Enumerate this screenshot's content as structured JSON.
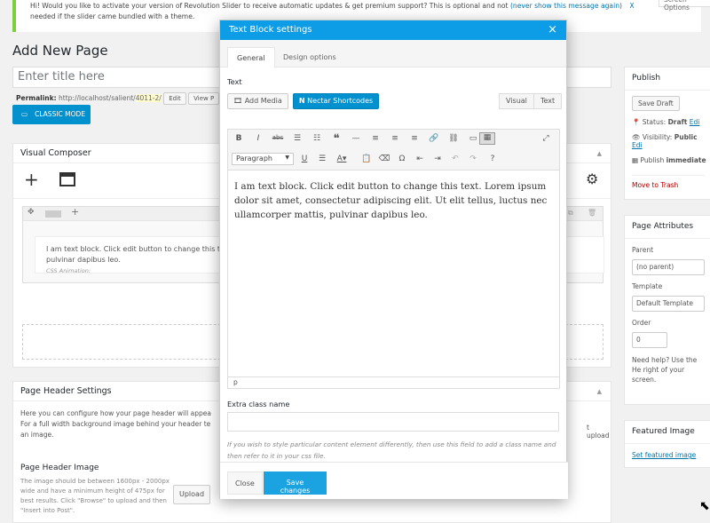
{
  "notice": {
    "text": "Hi! Would you like to activate your version of Revolution Slider to receive automatic updates & get premium support? This is optional and not",
    "link": "(never show this message again)",
    "dismiss": "X",
    "text2": "needed if the slider came bundled with a theme."
  },
  "screen_options": "Screen Options",
  "page": {
    "title": "Add New Page",
    "title_placeholder": "Enter title here",
    "permalink_label": "Permalink:",
    "permalink_url": "http://localhost/salient/",
    "permalink_slug": "4011-2/",
    "edit_btn": "Edit",
    "view_btn": "View P",
    "classic_mode": "CLASSIC MODE"
  },
  "vc": {
    "title": "Visual Composer",
    "element_text": "I am text block. Click edit button to change this text.",
    "element_text2": "pulvinar dapibus leo.",
    "css_animation": "CSS Animation:"
  },
  "page_header": {
    "title": "Page Header Settings",
    "desc1": "Here you can configure how your page header will appea",
    "desc2": "For a full width background image behind your header te",
    "desc3": "an image.",
    "desc_right": "t upload",
    "image_label": "Page Header Image",
    "image_desc": "The image should be between 1600px - 2000px wide and have a minimum height of 475px for best results. Click \"Browse\" to upload and then \"Insert into Post\".",
    "upload_btn": "Upload"
  },
  "publish": {
    "title": "Publish",
    "save_draft": "Save Draft",
    "status_label": "Status:",
    "status_value": "Draft",
    "status_edit": "Edi",
    "visibility_label": "Visibility:",
    "visibility_value": "Public",
    "visibility_edit": "Edi",
    "publish_label": "Publish",
    "publish_value": "immediate",
    "trash": "Move to Trash"
  },
  "page_attributes": {
    "title": "Page Attributes",
    "parent_label": "Parent",
    "parent_value": "(no parent)",
    "template_label": "Template",
    "template_value": "Default Template",
    "order_label": "Order",
    "order_value": "0",
    "help": "Need help? Use the He right of your screen."
  },
  "featured": {
    "title": "Featured Image",
    "link": "Set featured image"
  },
  "modal": {
    "title": "Text Block settings",
    "close": "×",
    "tabs": [
      "General",
      "Design options"
    ],
    "text_label": "Text",
    "add_media": "Add Media",
    "nectar": "Nectar Shortcodes",
    "visual_tab": "Visual",
    "text_tab": "Text",
    "format_select": "Paragraph",
    "content": "I am text block. Click edit button to change this text. Lorem ipsum dolor sit amet, consectetur adipiscing elit. Ut elit tellus, luctus nec ullamcorper mattis, pulvinar dapibus leo.",
    "path": "p",
    "extra_label": "Extra class name",
    "extra_help": "If you wish to style particular content element differently, then use this field to add a class name and then refer to it in your css file.",
    "close_btn": "Close",
    "save_btn": "Save changes"
  },
  "colors": {
    "accent": "#0091ce",
    "modal_header": "#0d9de6",
    "notice_border": "#7ad03a",
    "trash": "#a00"
  }
}
